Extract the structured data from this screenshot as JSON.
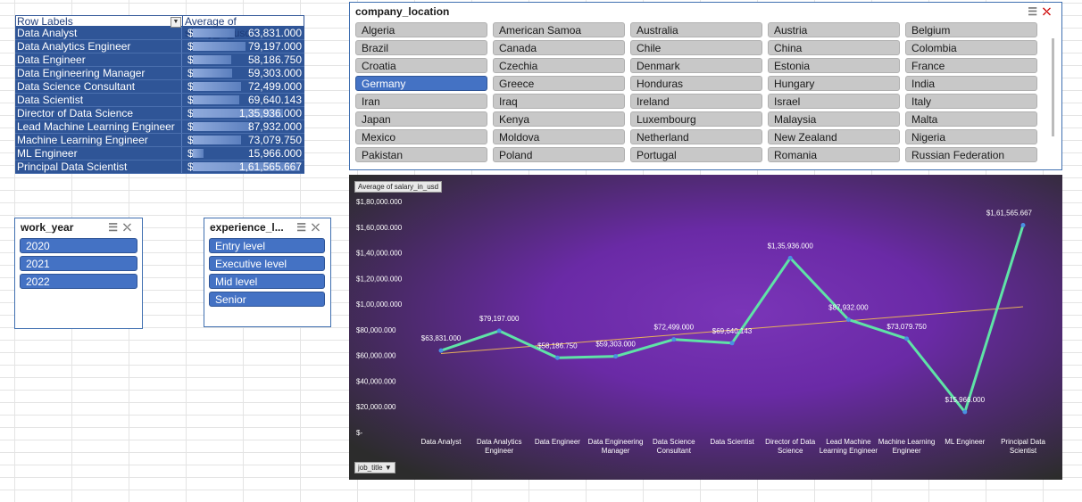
{
  "pivot": {
    "row_header": "Row Labels",
    "value_header": "Average of salary_in_usd",
    "currency": "$",
    "max": 161565.667,
    "rows": [
      {
        "label": "Data Analyst",
        "display": "63,831.000",
        "value": 63831
      },
      {
        "label": "Data Analytics Engineer",
        "display": "79,197.000",
        "value": 79197
      },
      {
        "label": "Data Engineer",
        "display": "58,186.750",
        "value": 58186.75
      },
      {
        "label": "Data Engineering Manager",
        "display": "59,303.000",
        "value": 59303
      },
      {
        "label": "Data Science Consultant",
        "display": "72,499.000",
        "value": 72499
      },
      {
        "label": "Data Scientist",
        "display": "69,640.143",
        "value": 69640.143
      },
      {
        "label": "Director of Data Science",
        "display": "1,35,936.000",
        "value": 135936
      },
      {
        "label": "Lead Machine Learning Engineer",
        "display": "87,932.000",
        "value": 87932
      },
      {
        "label": "Machine Learning Engineer",
        "display": "73,079.750",
        "value": 73079.75
      },
      {
        "label": "ML Engineer",
        "display": "15,966.000",
        "value": 15966
      },
      {
        "label": "Principal Data Scientist",
        "display": "1,61,565.667",
        "value": 161565.667
      }
    ]
  },
  "location_slicer": {
    "title": "company_location",
    "selected": "Germany",
    "items": [
      "Algeria",
      "American Samoa",
      "Australia",
      "Austria",
      "Belgium",
      "Brazil",
      "Canada",
      "Chile",
      "China",
      "Colombia",
      "Croatia",
      "Czechia",
      "Denmark",
      "Estonia",
      "France",
      "Germany",
      "Greece",
      "Honduras",
      "Hungary",
      "India",
      "Iran",
      "Iraq",
      "Ireland",
      "Israel",
      "Italy",
      "Japan",
      "Kenya",
      "Luxembourg",
      "Malaysia",
      "Malta",
      "Mexico",
      "Moldova",
      "Netherland",
      "New Zealand",
      "Nigeria",
      "Pakistan",
      "Poland",
      "Portugal",
      "Romania",
      "Russian Federation"
    ]
  },
  "work_year_slicer": {
    "title": "work_year",
    "items": [
      "2020",
      "2021",
      "2022"
    ]
  },
  "experience_slicer": {
    "title": "experience_l...",
    "items": [
      "Entry level",
      "Executive level",
      "Mid level",
      "Senior"
    ]
  },
  "colors": {
    "line": "#5fe3a7",
    "trend": "#e8b15a",
    "marker": "#4a90e2",
    "selected": "#4472c4"
  },
  "chart_data": {
    "type": "line",
    "field_chip": "Average of salary_in_usd",
    "axis_field": "job_title",
    "categories": [
      [
        "Data Analyst"
      ],
      [
        "Data Analytics",
        "Engineer"
      ],
      [
        "Data Engineer"
      ],
      [
        "Data Engineering",
        "Manager"
      ],
      [
        "Data Science",
        "Consultant"
      ],
      [
        "Data Scientist"
      ],
      [
        "Director of Data",
        "Science"
      ],
      [
        "Lead Machine",
        "Learning Engineer"
      ],
      [
        "Machine Learning",
        "Engineer"
      ],
      [
        "ML Engineer"
      ],
      [
        "Principal Data",
        "Scientist"
      ]
    ],
    "values": [
      63831,
      79197,
      58186.75,
      59303,
      72499,
      69640.143,
      135936,
      87932,
      73079.75,
      15966,
      161565.667
    ],
    "data_labels": [
      "$63,831.000",
      "$79,197.000",
      "$58,186.750",
      "$59,303.000",
      "$72,499.000",
      "$69,640.143",
      "$1,35,936.000",
      "$87,932.000",
      "$73,079.750",
      "$15,966.000",
      "$1,61,565.667"
    ],
    "y_ticks": [
      0,
      20000,
      40000,
      60000,
      80000,
      100000,
      120000,
      140000,
      160000,
      180000
    ],
    "y_tick_labels": [
      "$-",
      "$20,000.000",
      "$40,000.000",
      "$60,000.000",
      "$80,000.000",
      "$1,00,000.000",
      "$1,20,000.000",
      "$1,40,000.000",
      "$1,60,000.000",
      "$1,80,000.000"
    ],
    "ylim": [
      0,
      180000
    ],
    "trendline": true
  }
}
